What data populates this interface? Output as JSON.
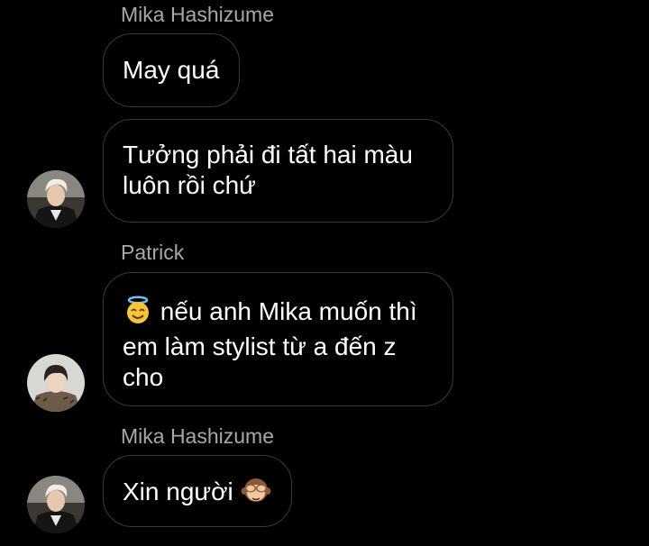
{
  "thread": {
    "messages": [
      {
        "sender": "Mika Hashizume",
        "bubbles": [
          {
            "text": "May quá"
          },
          {
            "text": "Tưởng phải đi tất hai màu luôn rồi chứ"
          }
        ]
      },
      {
        "sender": "Patrick",
        "bubbles": [
          {
            "emoji": "smiling-face-with-halo-icon",
            "text": "nếu anh Mika muốn thì em làm stylist từ a đến z cho"
          }
        ]
      },
      {
        "sender": "Mika Hashizume",
        "bubbles": [
          {
            "text": "Xin người",
            "emoji": "see-no-evil-monkey-icon"
          }
        ]
      }
    ]
  },
  "colors": {
    "background": "#000000",
    "bubble_border": "#3a3a3a",
    "sender_text": "#a8a8a8",
    "message_text": "#ffffff"
  }
}
